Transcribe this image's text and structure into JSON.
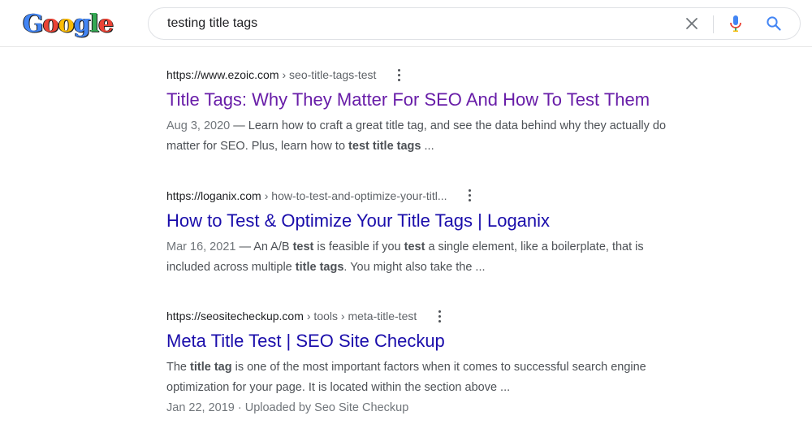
{
  "header": {
    "logo_text": "Google",
    "search_value": "testing title tags",
    "clear_icon": "close-icon",
    "mic_icon": "microphone-icon",
    "search_icon": "search-icon"
  },
  "results": [
    {
      "domain": "https://www.ezoic.com",
      "path": "› seo-title-tags-test",
      "title": "Title Tags: Why They Matter For SEO And How To Test Them",
      "visited": true,
      "snippet_line1": {
        "date": "Aug 3, 2020",
        "sep": " — ",
        "text": "Learn how to craft a great title tag, and see the data behind why they actually do"
      },
      "snippet_line2": {
        "a": "matter for SEO. Plus, learn how to ",
        "b": "test title tags",
        "c": " ..."
      }
    },
    {
      "domain": "https://loganix.com",
      "path": "› how-to-test-and-optimize-your-titl...",
      "title": "How to Test & Optimize Your Title Tags | Loganix",
      "visited": false,
      "snippet_line1": {
        "date": "Mar 16, 2021",
        "sep": " — ",
        "a": "An A/B ",
        "b": "test",
        "c": " is feasible if you ",
        "d": "test",
        "e": " a single element, like a boilerplate, that is"
      },
      "snippet_line2": {
        "a": "included across multiple ",
        "b": "title tags",
        "c": ". You might also take the ..."
      }
    },
    {
      "domain": "https://seositecheckup.com",
      "path": "› tools › meta-title-test",
      "title": "Meta Title Test | SEO Site Checkup",
      "visited": false,
      "snippet_line1": {
        "a": "The ",
        "b": "title tag",
        "c": " is one of the most important factors when it comes to successful search engine"
      },
      "snippet_line2": {
        "a": "optimization for your page. It is located within the section above ..."
      },
      "meta": "Jan 22, 2019 · Uploaded by Seo Site Checkup"
    }
  ],
  "colors": {
    "visited_link": "#681da8",
    "link": "#1a0dab",
    "snippet": "#4d5156"
  }
}
